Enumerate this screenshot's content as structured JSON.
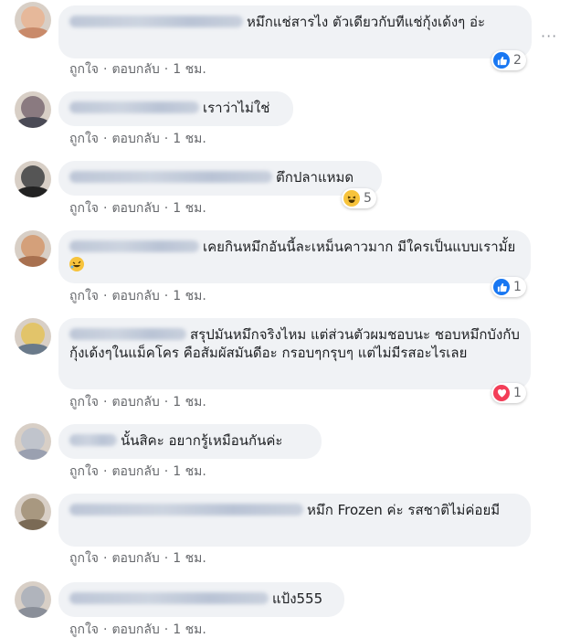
{
  "actions": {
    "like": "ถูกใจ",
    "reply": "ตอบกลับ",
    "time": "1 ชม.",
    "sep": "·"
  },
  "more_icon": "···",
  "comments": [
    {
      "text": "หมึกแช่สารไง ตัวเดียวกับทีแช่กุ้งเด้งๆ อ่ะ",
      "reaction": {
        "type": "like",
        "count": "2"
      },
      "avatar_color": "#c98a6a"
    },
    {
      "text": "เราว่าไม่ใช่",
      "reaction": null,
      "avatar_color": "#4a4a55"
    },
    {
      "text": "ตึกปลาแหมด",
      "reaction": {
        "type": "haha",
        "count": "5"
      },
      "avatar_color": "#2a2a2a"
    },
    {
      "text": "เคยกินหมึกอันนี้ละเหม็นคาวมาก มีใครเป็นแบบเรามั้ย",
      "emoji": "rolling-laughing-emoji",
      "reaction": {
        "type": "like",
        "count": "1"
      },
      "avatar_color": "#a8704f"
    },
    {
      "text": "สรุปมันหมึกจริงไหม แต่ส่วนตัวผมชอบนะ ชอบหมึกบังกับกุ้งเด้งๆในแม็คโคร คือสัมผัสมันดีอะ กรอบๆกรุบๆ แต่ไม่มีรสอะไรเลย",
      "reaction": {
        "type": "love",
        "count": "1"
      },
      "avatar_color": "#c2a24a"
    },
    {
      "text": "นั้นสิคะ อยากรู้เหมือนกันค่ะ",
      "reaction": null,
      "avatar_color": "#9aa0b0"
    },
    {
      "text": "หมึก Frozen ค่ะ รสชาติไม่ค่อยมี",
      "reaction": null,
      "avatar_color": "#7a6a55"
    },
    {
      "text": "แป้ง555",
      "reaction": null,
      "avatar_color": "#8a8f99"
    }
  ],
  "colors": {
    "like": "#1877f2",
    "love": "#f33e58",
    "haha": "#f7c33b",
    "bubble": "#f0f2f5"
  }
}
